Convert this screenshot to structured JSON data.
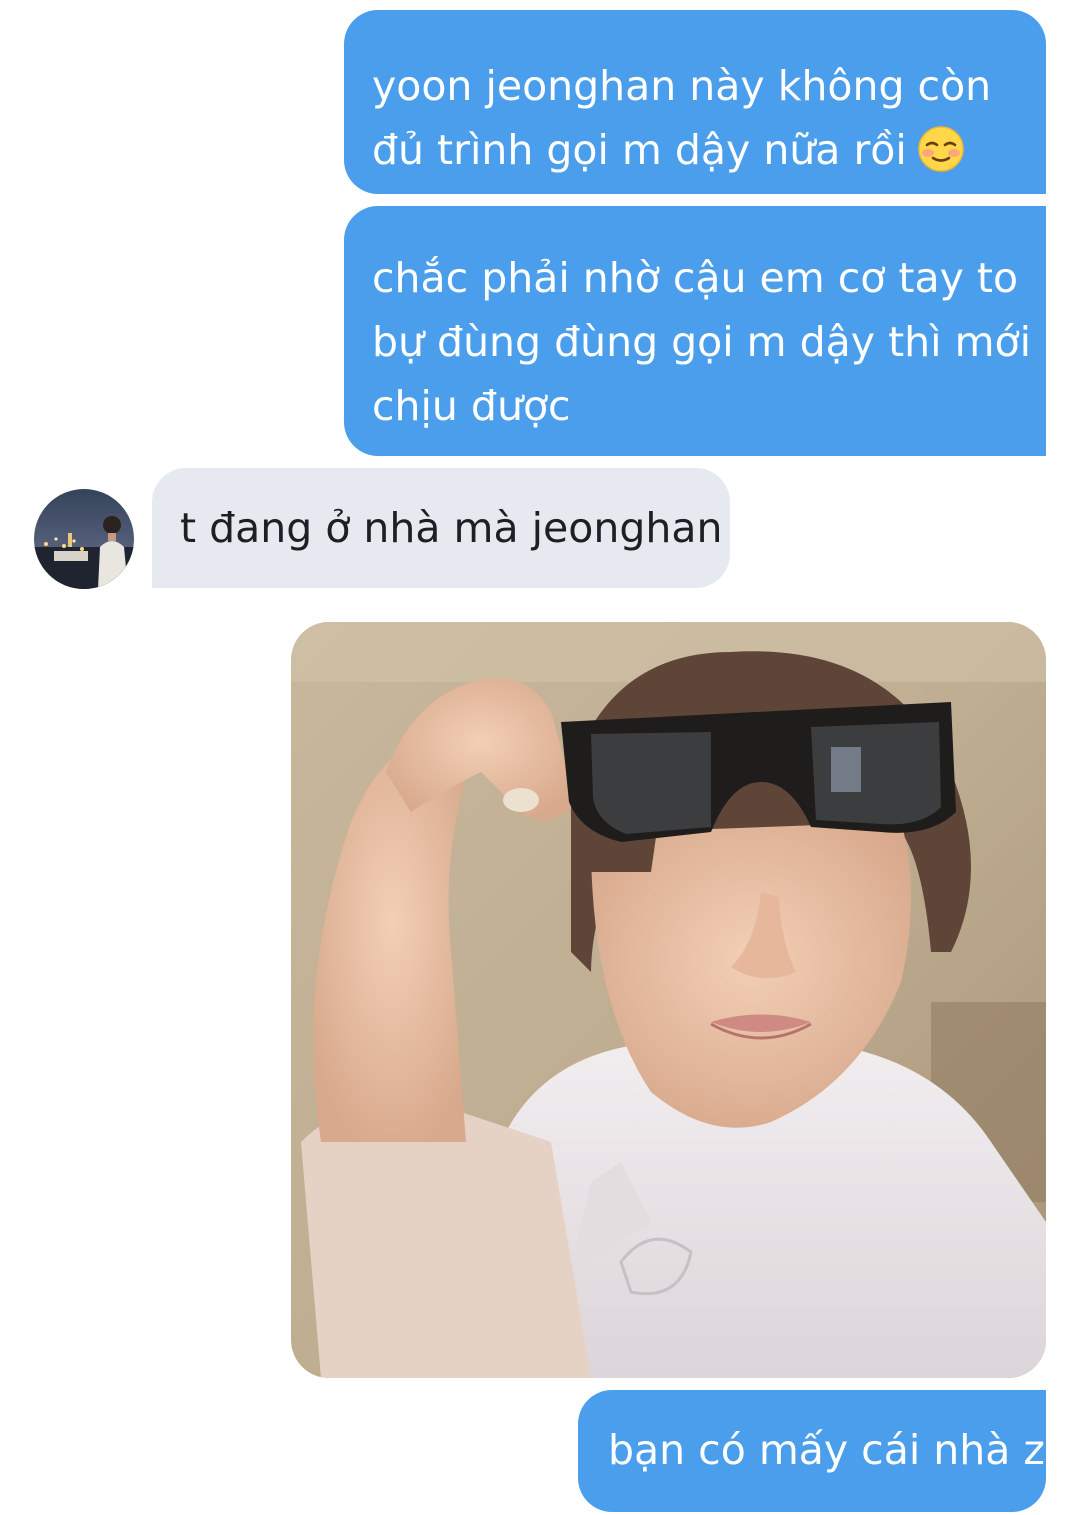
{
  "conversation": {
    "messages": [
      {
        "sender": "me",
        "lines": [
          "yoon jeonghan này không còn",
          "đủ trình gọi m dậy nữa rồi"
        ],
        "emoji_icon": "smiling-blush-emoji-icon"
      },
      {
        "sender": "me",
        "lines": [
          "chắc phải nhờ cậu em cơ tay to",
          "bự đùng đùng gọi m dậy thì mới",
          "chịu được"
        ]
      },
      {
        "sender": "friend",
        "lines": [
          "t đang ở nhà mà jeonghan"
        ],
        "avatar_icon": "friend-avatar"
      },
      {
        "sender": "me",
        "type": "image",
        "image_icon": "selfie-with-sunglasses-photo"
      },
      {
        "sender": "me",
        "lines": [
          "bạn có mấy cái nhà z"
        ]
      }
    ]
  },
  "colors": {
    "outgoing_bubble": "#4a9eeb",
    "incoming_bubble": "#e6e9ef",
    "outgoing_text": "#ffffff",
    "incoming_text": "#1d1f22"
  }
}
